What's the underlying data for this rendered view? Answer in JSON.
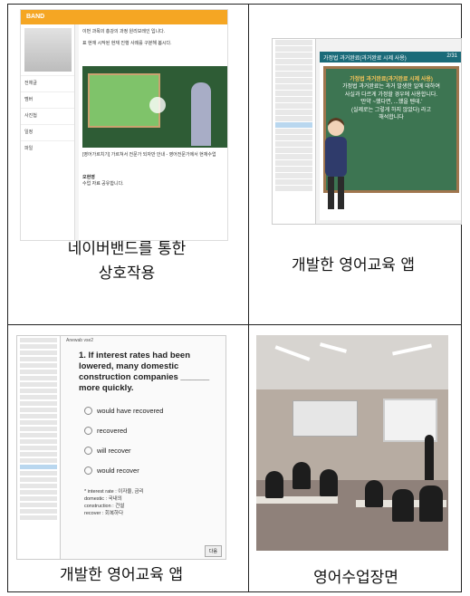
{
  "captions": {
    "top_left_line1": "네이버밴드를 통한",
    "top_left_line2": "상호작용",
    "top_right": "개발한 영어교육 앱",
    "bottom_left": "개발한 영어교육 앱",
    "bottom_right": "영어수업장면"
  },
  "band": {
    "logo": "BAND",
    "post_line1": "이번 과목의 총강의 과정 원리보레인 입니다.",
    "post_line2": "표 현재 시작된 현재 진행 사례를 구분해 봅시다.",
    "video_title": "[영어가르치기] 가르쳐서 전문가 되자만 안내 - 영어전문가에서 현재수업",
    "commenter": "오현영",
    "comment_text": "수업 자료 공유합니다.",
    "side_labels": [
      "전체글",
      "멤버",
      "사진첩",
      "일정",
      "파일"
    ]
  },
  "app1": {
    "title": "가정법 과거완료(과거완료 시제 사용)",
    "page": "2/31",
    "board_heading": "가정법 과거완료(과거완료 시제 사용)",
    "board_line1": "가정법 과거완료는 과거 발생한 일에 대하여",
    "board_line2": "사실과 다르게 가정할 경우에 사용합니다.",
    "board_line3": "'만약 ~했다면, ...했을 텐데.'",
    "board_line4": "(실제로는 그렇게 하지 않았다) 라고",
    "board_line5": "해석합니다"
  },
  "app2": {
    "head": "Anewab vse2",
    "question": "1. If interest rates had been lowered, many domestic construction companies ______ more quickly.",
    "options": [
      "would have recovered",
      "recovered",
      "will recover",
      "would recover"
    ],
    "notes": [
      "* interest rate : 이자율, 금리",
      "domestic : 국내의",
      "construction : 건설",
      "recover : 회복하다"
    ],
    "button": "다음"
  },
  "colors": {
    "band_orange": "#f5a623",
    "board_green": "#3d7552",
    "app_title_teal": "#1b6b79"
  }
}
